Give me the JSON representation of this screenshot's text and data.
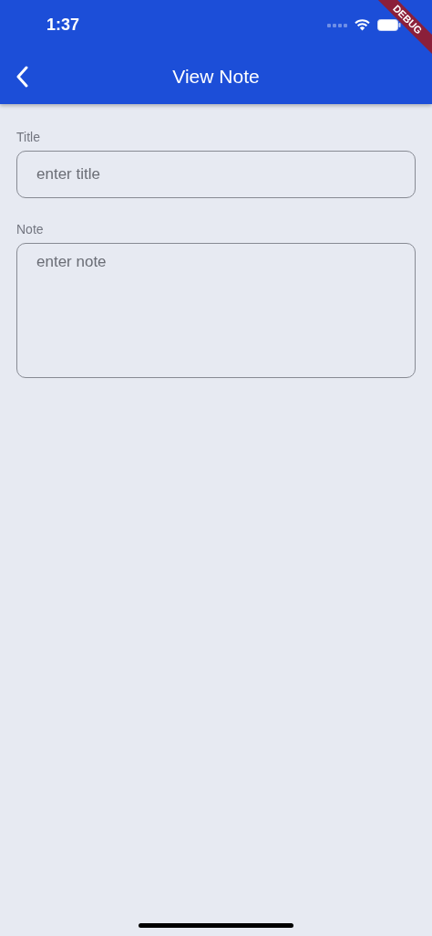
{
  "status_bar": {
    "time": "1:37"
  },
  "debug_banner": {
    "label": "DEBUG"
  },
  "app_bar": {
    "title": "View Note"
  },
  "fields": [
    {
      "label": "Title",
      "placeholder": "enter title",
      "kind": "single"
    },
    {
      "label": "Note",
      "placeholder": "enter note",
      "kind": "multiline"
    }
  ]
}
